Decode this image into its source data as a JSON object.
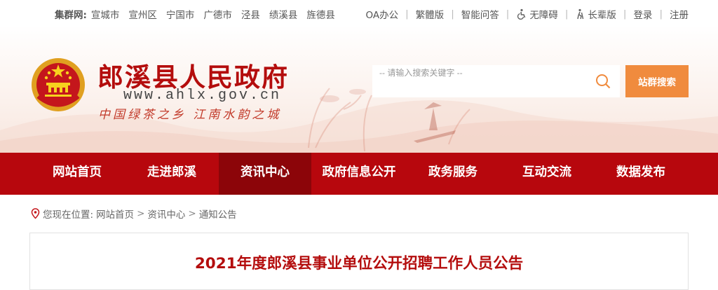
{
  "topbar": {
    "cluster_label": "集群网:",
    "cluster_links": [
      "宣城市",
      "宣州区",
      "宁国市",
      "广德市",
      "泾县",
      "绩溪县",
      "旌德县"
    ],
    "oa": "OA办公",
    "traditional": "繁體版",
    "smart_qa": "智能问答",
    "accessibility": "无障碍",
    "elder": "长辈版",
    "login": "登录",
    "register": "注册",
    "separator": "|"
  },
  "header": {
    "title": "郎溪县人民政府",
    "url": "www.ahlx.gov.cn",
    "slogan": "中国绿茶之乡  江南水韵之城"
  },
  "search": {
    "placeholder": "-- 请输入搜索关键字 --",
    "button": "站群搜索"
  },
  "nav": {
    "items": [
      "网站首页",
      "走进郎溪",
      "资讯中心",
      "政府信息公开",
      "政务服务",
      "互动交流",
      "数据发布"
    ],
    "active_index": 2
  },
  "breadcrumb": {
    "prefix": "您现在位置:",
    "items": [
      "网站首页",
      "资讯中心",
      "通知公告"
    ],
    "sep": ">"
  },
  "article": {
    "title": "2021年度郎溪县事业单位公开招聘工作人员公告"
  },
  "colors": {
    "brand_red": "#b7070d",
    "nav_active": "#8c0509",
    "search_orange": "#f08b3e",
    "title_red": "#b40d0d"
  }
}
